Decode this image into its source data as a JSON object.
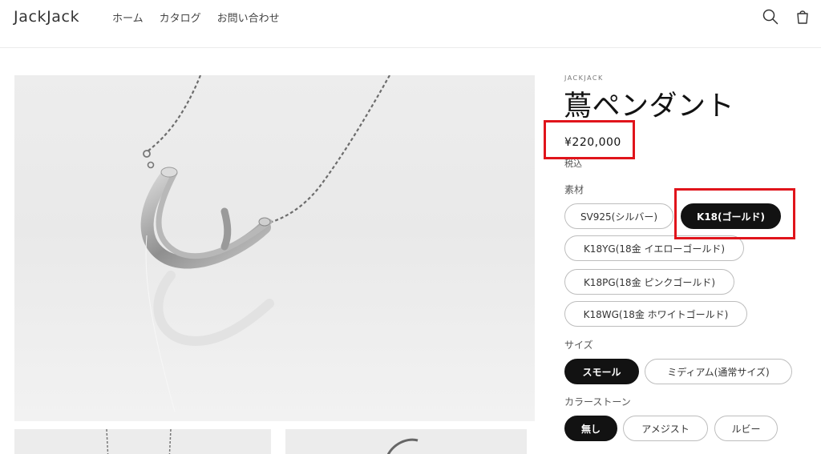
{
  "header": {
    "logo": "JackJack",
    "nav": [
      "ホーム",
      "カタログ",
      "お問い合わせ"
    ],
    "icons": [
      "search-icon",
      "cart-icon"
    ]
  },
  "product": {
    "vendor": "JACKJACK",
    "title": "蔦ペンダント",
    "price": "¥220,000",
    "tax_note": "税込"
  },
  "options": {
    "material": {
      "label": "素材",
      "values": [
        "SV925(シルバー)",
        "K18(ゴールド)",
        "K18YG(18金 イエローゴールド)",
        "K18PG(18金 ピンクゴールド)",
        "K18WG(18金 ホワイトゴールド)"
      ],
      "selected": "K18(ゴールド)"
    },
    "size": {
      "label": "サイズ",
      "values": [
        "スモール",
        "ミディアム(通常サイズ)"
      ],
      "selected": "スモール"
    },
    "stone": {
      "label": "カラーストーン",
      "values": [
        "無し",
        "アメジスト",
        "ルビー"
      ],
      "selected": "無し"
    }
  },
  "colors": {
    "highlight": "#e0141b",
    "selected_bg": "#121212",
    "border": "#bdbdbd"
  }
}
